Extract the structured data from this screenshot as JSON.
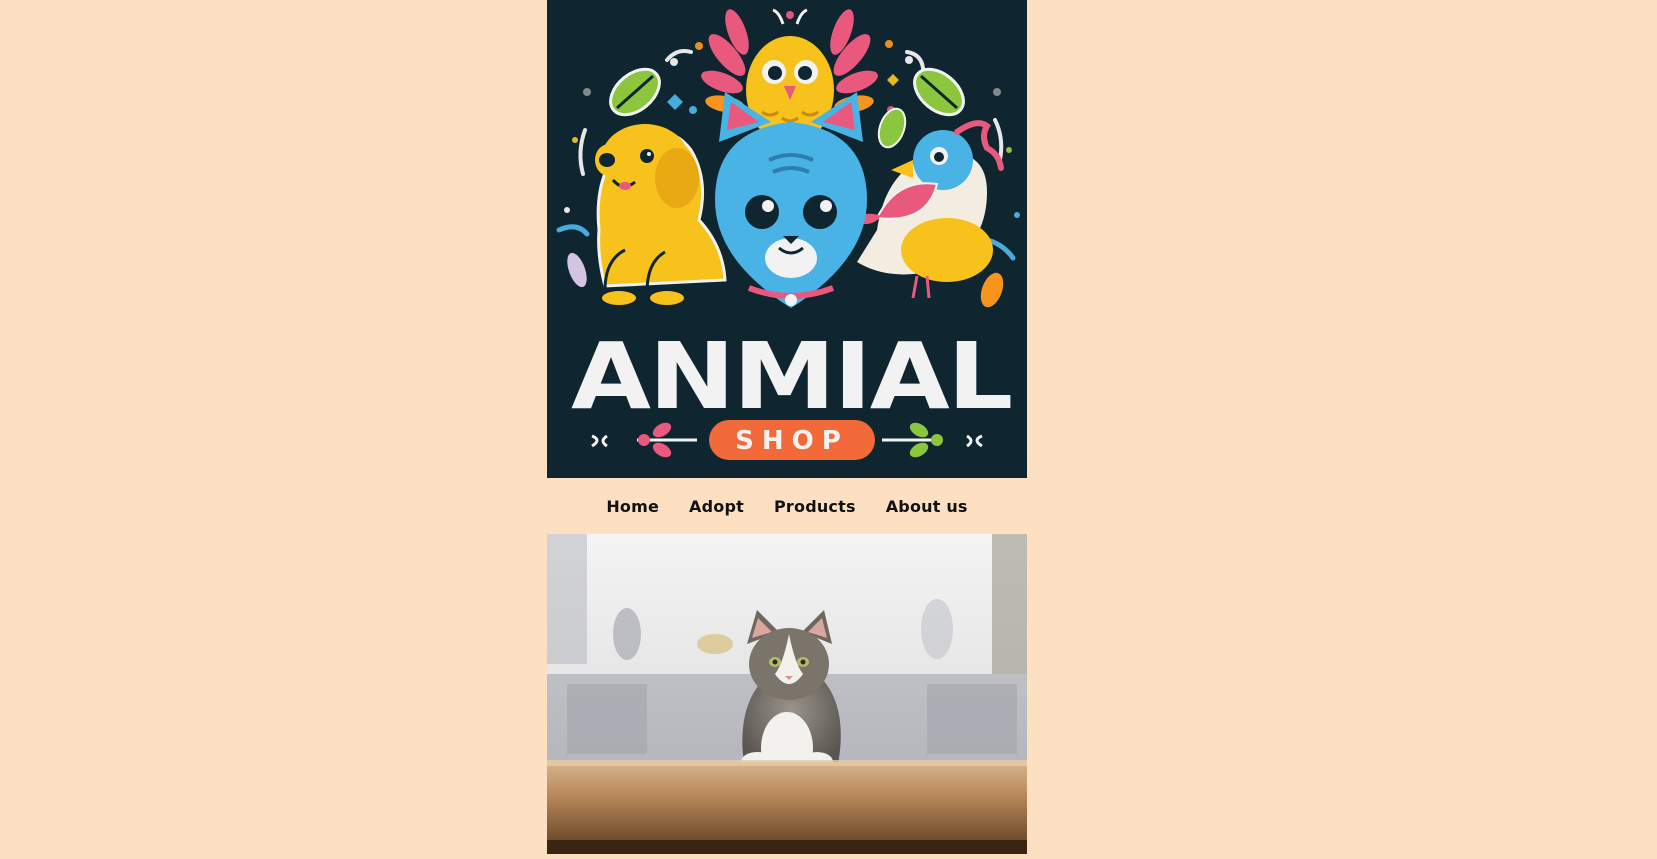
{
  "theme": {
    "page_bg": "#fde0c2",
    "logo_bg": "#0f2530",
    "nav_text": "#111111",
    "shop_badge": "#f26a3a"
  },
  "logo": {
    "title": "ANMIAL",
    "badge": "SHOP",
    "mascots": [
      "dog-illustration",
      "cat-illustration",
      "owl-illustration",
      "bird-illustration"
    ]
  },
  "nav": {
    "items": [
      {
        "label": "Home"
      },
      {
        "label": "Adopt"
      },
      {
        "label": "Products"
      },
      {
        "label": "About us"
      }
    ]
  },
  "hero": {
    "image": "cat-on-table-photo"
  }
}
